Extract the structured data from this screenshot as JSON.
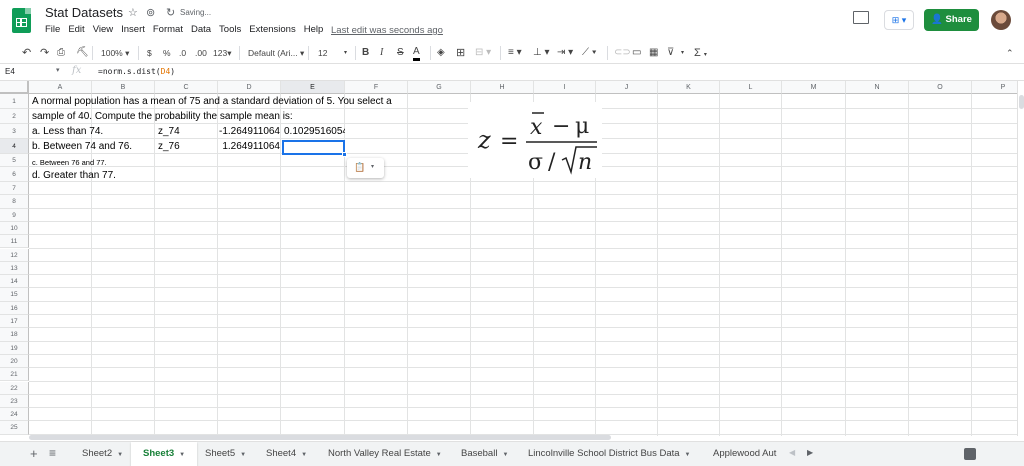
{
  "app": {
    "doc_title": "Stat Datasets",
    "saving_status": "Saving...",
    "last_edit": "Last edit was seconds ago",
    "share_label": "Share",
    "brand_color": "#0f9d58",
    "share_color": "#1e8e3e"
  },
  "menu": [
    "File",
    "Edit",
    "View",
    "Insert",
    "Format",
    "Data",
    "Tools",
    "Extensions",
    "Help"
  ],
  "toolbar": {
    "zoom": "100%",
    "currency": "$",
    "percent": "%",
    "decrease_decimal": ".0",
    "increase_decimal": ".00",
    "more_formats": "123",
    "font": "Default (Ari...",
    "font_size": "12",
    "bold": "B",
    "italic": "I",
    "strikethrough": "S",
    "text_color": "A",
    "sum": "Σ"
  },
  "formula_bar": {
    "cell_ref": "E4",
    "formula_prefix": "=norm.s.dist(",
    "formula_ref": "D4",
    "formula_suffix": ")"
  },
  "columns": [
    "A",
    "B",
    "C",
    "D",
    "E",
    "F",
    "G",
    "H",
    "I",
    "J",
    "K",
    "L",
    "M",
    "N",
    "O",
    "P"
  ],
  "rows": [
    "1",
    "2",
    "3",
    "4",
    "5",
    "6",
    "7",
    "8",
    "9",
    "10",
    "11",
    "12",
    "13",
    "14",
    "15",
    "16",
    "17",
    "18",
    "19",
    "20",
    "21",
    "22",
    "23",
    "24",
    "25"
  ],
  "cells": {
    "A1": "A normal population has a mean of 75 and a standard deviation of 5. You select a",
    "A2": "sample of 40. Compute the probability the sample mean is:",
    "A3": "a. Less than 74.",
    "C3": "z_74",
    "D3": "-1.264911064",
    "E3": "0.1029516054",
    "A4": "b. Between 74 and 76.",
    "C4": "z_76",
    "D4": "1.264911064",
    "A5": "c. Between 76 and 77.",
    "A6": "d. Greater than 77."
  },
  "formula_image": {
    "z": "z",
    "equals": "=",
    "x_bar": "x",
    "minus": "−",
    "mu": "μ",
    "sigma": "σ",
    "slash": "/",
    "n": "n"
  },
  "sheet_tabs": [
    {
      "label": "Sheet2",
      "active": false
    },
    {
      "label": "Sheet3",
      "active": true
    },
    {
      "label": "Sheet5",
      "active": false
    },
    {
      "label": "Sheet4",
      "active": false
    },
    {
      "label": "North Valley Real Estate",
      "active": false
    },
    {
      "label": "Baseball",
      "active": false
    },
    {
      "label": "Lincolnville School District Bus Data",
      "active": false
    },
    {
      "label": "Applewood Aut",
      "active": false
    }
  ],
  "selected_cell": "E4",
  "active_tab_color": "#188038",
  "selection_color": "#1a73e8"
}
